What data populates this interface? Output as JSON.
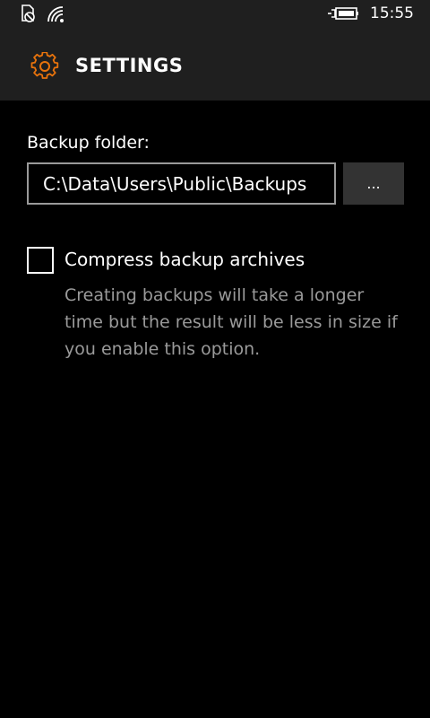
{
  "status_bar": {
    "time": "15:55",
    "icons": [
      "notification-blocked-icon",
      "wifi-signal-icon",
      "battery-charging-icon"
    ]
  },
  "header": {
    "title": "SETTINGS",
    "icon": "gear-icon",
    "accent_color": "#e8730c"
  },
  "backup": {
    "folder_label": "Backup folder:",
    "folder_value": "C:\\Data\\Users\\Public\\Backups",
    "browse_label": "..."
  },
  "compress": {
    "checked": false,
    "label": "Compress backup archives",
    "description": "Creating backups will take a longer time but the result will be less in size if you enable this option."
  }
}
